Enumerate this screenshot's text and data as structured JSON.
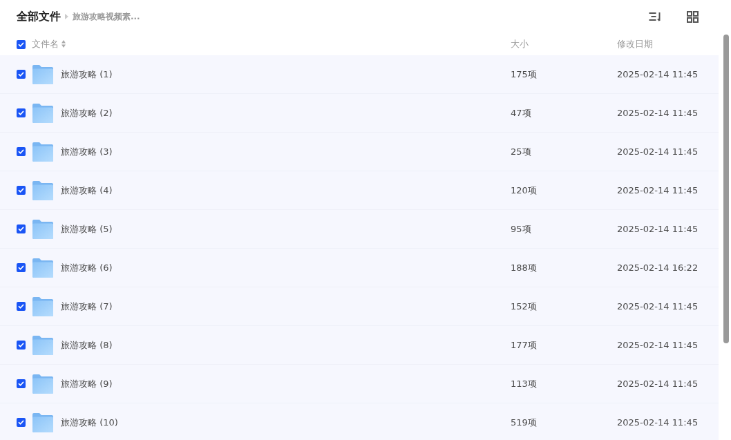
{
  "header": {
    "title": "全部文件",
    "breadcrumb": "旅游攻略视频素..."
  },
  "select_all": {
    "checked": true
  },
  "columns": [
    {
      "label": "文件名",
      "sortable": true
    },
    {
      "label": "大小",
      "sortable": false
    },
    {
      "label": "修改日期",
      "sortable": false
    }
  ],
  "rows": [
    {
      "name": "旅游攻略 (1)",
      "size": "175项",
      "modified": "2025-02-14 11:45",
      "selected": true
    },
    {
      "name": "旅游攻略 (2)",
      "size": "47项",
      "modified": "2025-02-14 11:45",
      "selected": true
    },
    {
      "name": "旅游攻略 (3)",
      "size": "25项",
      "modified": "2025-02-14 11:45",
      "selected": true
    },
    {
      "name": "旅游攻略 (4)",
      "size": "120项",
      "modified": "2025-02-14 11:45",
      "selected": true
    },
    {
      "name": "旅游攻略 (5)",
      "size": "95项",
      "modified": "2025-02-14 11:45",
      "selected": true
    },
    {
      "name": "旅游攻略 (6)",
      "size": "188项",
      "modified": "2025-02-14 16:22",
      "selected": true
    },
    {
      "name": "旅游攻略 (7)",
      "size": "152项",
      "modified": "2025-02-14 11:45",
      "selected": true
    },
    {
      "name": "旅游攻略 (8)",
      "size": "177项",
      "modified": "2025-02-14 11:45",
      "selected": true
    },
    {
      "name": "旅游攻略 (9)",
      "size": "113项",
      "modified": "2025-02-14 11:45",
      "selected": true
    },
    {
      "name": "旅游攻略 (10)",
      "size": "519项",
      "modified": "2025-02-14 11:45",
      "selected": true
    }
  ]
}
